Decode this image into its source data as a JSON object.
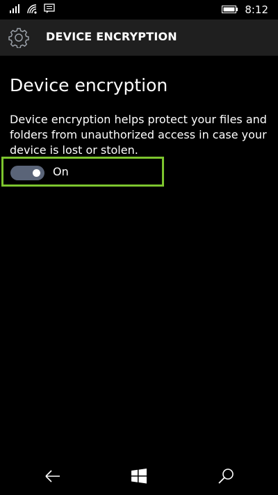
{
  "status_bar": {
    "time": "8:12",
    "icons": [
      "signal-icon",
      "wifi-icon",
      "notification-icon",
      "battery-icon"
    ]
  },
  "header": {
    "title": "DEVICE ENCRYPTION",
    "icon": "gear-icon"
  },
  "main": {
    "heading": "Device encryption",
    "description": "Device encryption helps protect your files and folders from unauthorized access in case your device is lost or stolen.",
    "toggle": {
      "state_label": "On",
      "is_on": true
    }
  },
  "nav_bar": {
    "buttons": [
      "back-icon",
      "windows-icon",
      "search-icon"
    ]
  },
  "colors": {
    "highlight_border": "#7dc52e",
    "toggle_track": "#5a6478",
    "header_background": "#1f1f1f"
  }
}
